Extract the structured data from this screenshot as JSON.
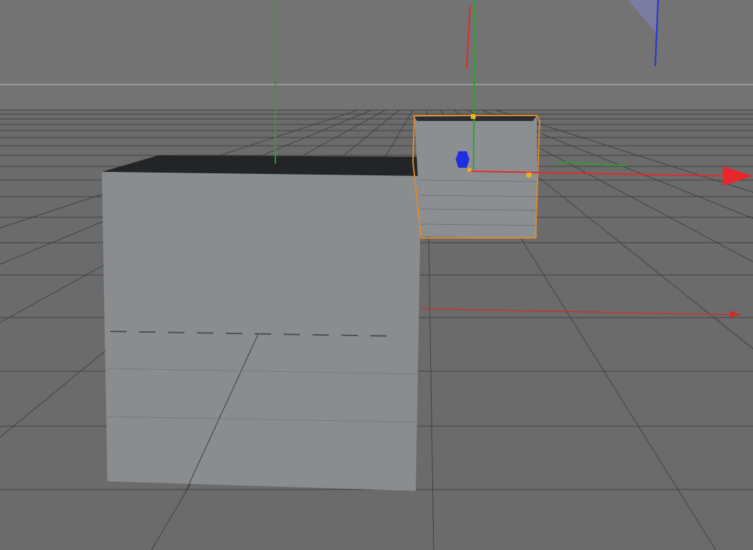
{
  "viewport": {
    "background_color": "#6b6b6b",
    "horizon_color": "#9b9b9b",
    "grid_color": "#3a3a3a"
  },
  "scene": {
    "objects": [
      {
        "id": "cube-large",
        "kind": "cube",
        "selected": false,
        "face_color": "#8a8d90",
        "top_color": "#222426"
      },
      {
        "id": "cube-selected",
        "kind": "cube",
        "selected": true,
        "face_color": "#8c8f92",
        "top_color": "#2a2c2e",
        "outline_color": "#e08a2e"
      }
    ]
  },
  "gizmo": {
    "x_axis_color": "#e8262b",
    "y_axis_color": "#2ca02c",
    "z_axis_color": "#1f2fe0",
    "handle_color": "#f2b01e"
  }
}
